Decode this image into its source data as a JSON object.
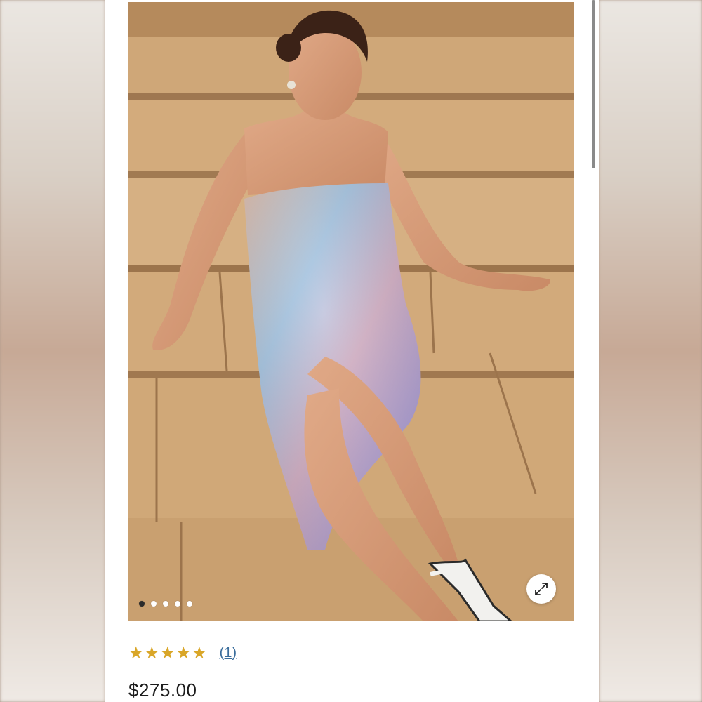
{
  "product": {
    "image_alt": "Model in strapless iridescent sequin midi dress sitting on stone steps",
    "rating": {
      "stars": 5,
      "review_count_label": "(1)",
      "star_color": "#d9a628"
    },
    "price": "$275.00"
  },
  "carousel": {
    "total_slides": 5,
    "active_index": 0
  },
  "icons": {
    "expand": "expand-arrows-icon",
    "star": "star-icon"
  },
  "colors": {
    "link": "#3a6d9c",
    "text": "#1c1c1c",
    "active_dot": "#2b2b2b"
  }
}
